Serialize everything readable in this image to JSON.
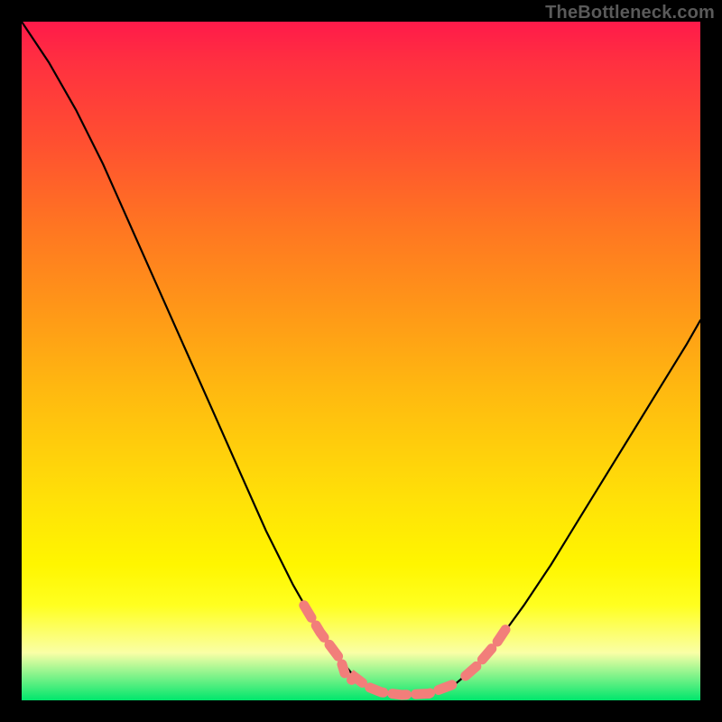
{
  "watermark": "TheBottleneck.com",
  "chart_data": {
    "type": "line",
    "title": "",
    "xlabel": "",
    "ylabel": "",
    "xlim": [
      0,
      1
    ],
    "ylim": [
      0,
      1
    ],
    "series": [
      {
        "name": "curve",
        "color": "#000000",
        "points": [
          [
            0.0,
            1.0
          ],
          [
            0.04,
            0.94
          ],
          [
            0.08,
            0.87
          ],
          [
            0.12,
            0.79
          ],
          [
            0.16,
            0.7
          ],
          [
            0.2,
            0.61
          ],
          [
            0.24,
            0.52
          ],
          [
            0.28,
            0.43
          ],
          [
            0.32,
            0.34
          ],
          [
            0.36,
            0.25
          ],
          [
            0.4,
            0.17
          ],
          [
            0.44,
            0.1
          ],
          [
            0.47,
            0.06
          ],
          [
            0.49,
            0.035
          ],
          [
            0.51,
            0.02
          ],
          [
            0.53,
            0.012
          ],
          [
            0.56,
            0.008
          ],
          [
            0.6,
            0.01
          ],
          [
            0.64,
            0.025
          ],
          [
            0.67,
            0.05
          ],
          [
            0.7,
            0.085
          ],
          [
            0.74,
            0.14
          ],
          [
            0.78,
            0.2
          ],
          [
            0.82,
            0.265
          ],
          [
            0.86,
            0.33
          ],
          [
            0.9,
            0.395
          ],
          [
            0.94,
            0.46
          ],
          [
            0.98,
            0.525
          ],
          [
            1.0,
            0.56
          ]
        ]
      }
    ],
    "annotations": {
      "pink_dash_segments": [
        {
          "start": [
            0.416,
            0.14
          ],
          "end": [
            0.476,
            0.04
          ]
        },
        {
          "start": [
            0.486,
            0.03
          ],
          "end": [
            0.64,
            0.022
          ]
        },
        {
          "start": [
            0.654,
            0.036
          ],
          "end": [
            0.718,
            0.112
          ]
        }
      ],
      "pink_color": "#f27e7a"
    },
    "background_gradient": {
      "type": "vertical",
      "stops": [
        [
          0.0,
          "#ff1a4a"
        ],
        [
          0.4,
          "#ff9618"
        ],
        [
          0.8,
          "#fff600"
        ],
        [
          1.0,
          "#00e66c"
        ]
      ]
    }
  }
}
